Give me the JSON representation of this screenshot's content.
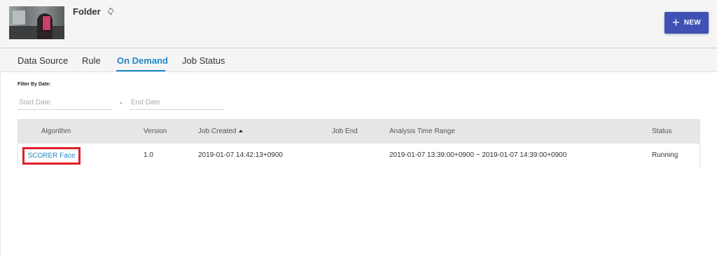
{
  "header": {
    "title": "Folder",
    "new_button_label": "NEW"
  },
  "tabs": [
    {
      "label": "Data Source"
    },
    {
      "label": "Rule"
    },
    {
      "label": "On Demand",
      "active": true
    },
    {
      "label": "Job Status"
    }
  ],
  "filter": {
    "label": "Filter By Date:",
    "start_placeholder": "Start Date",
    "separator": "-",
    "end_placeholder": "End Date"
  },
  "table": {
    "columns": [
      "Algorithm",
      "Version",
      "Job Created",
      "Job End",
      "Analysis Time Range",
      "Status"
    ],
    "sorted_column": "Job Created",
    "rows": [
      {
        "algorithm": "SCORER Face",
        "version": "1.0",
        "job_created": "2019-01-07 14:42:13+0900",
        "job_end": "",
        "analysis_time_range": "2019-01-07 13:39:00+0900 ~ 2019-01-07 14:39:00+0900",
        "status": "Running"
      }
    ]
  },
  "colors": {
    "accent": "#1e88c7",
    "primary_button": "#3f51b5",
    "highlight_box": "#e0202a"
  }
}
